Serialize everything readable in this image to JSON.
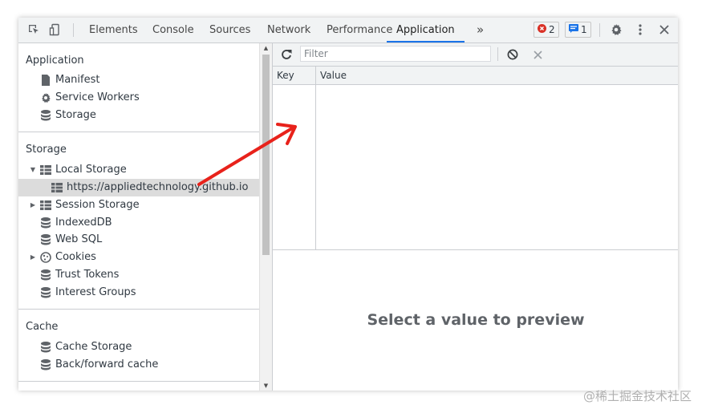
{
  "toolbar": {
    "tabs": [
      {
        "label": "Elements"
      },
      {
        "label": "Console"
      },
      {
        "label": "Sources"
      },
      {
        "label": "Network"
      },
      {
        "label": "Performance"
      },
      {
        "label": "Application"
      }
    ],
    "active_tab": "Application",
    "more_tabs": "»",
    "error_count": "2",
    "message_count": "1",
    "colors": {
      "accent": "#1a73e8",
      "error": "#d93025",
      "message": "#1a73e8"
    }
  },
  "sidebar": {
    "application": {
      "title": "Application",
      "items": [
        {
          "label": "Manifest",
          "icon": "file-icon"
        },
        {
          "label": "Service Workers",
          "icon": "gear-icon"
        },
        {
          "label": "Storage",
          "icon": "database-icon"
        }
      ]
    },
    "storage": {
      "title": "Storage",
      "items": [
        {
          "label": "Local Storage",
          "icon": "table-icon",
          "expanded": true
        },
        {
          "label": "https://appliedtechnology.github.io",
          "icon": "table-icon",
          "selected": true
        },
        {
          "label": "Session Storage",
          "icon": "table-icon",
          "expanded": false
        },
        {
          "label": "IndexedDB",
          "icon": "database-icon"
        },
        {
          "label": "Web SQL",
          "icon": "database-icon"
        },
        {
          "label": "Cookies",
          "icon": "cookie-icon",
          "expanded": false
        },
        {
          "label": "Trust Tokens",
          "icon": "database-icon"
        },
        {
          "label": "Interest Groups",
          "icon": "database-icon"
        }
      ]
    },
    "cache": {
      "title": "Cache",
      "items": [
        {
          "label": "Cache Storage",
          "icon": "database-icon"
        },
        {
          "label": "Back/forward cache",
          "icon": "database-icon"
        }
      ]
    }
  },
  "main": {
    "filter_placeholder": "Filter",
    "columns": {
      "key": "Key",
      "value": "Value"
    },
    "preview_text": "Select a value to preview"
  },
  "watermark": "@稀土掘金技术社区"
}
